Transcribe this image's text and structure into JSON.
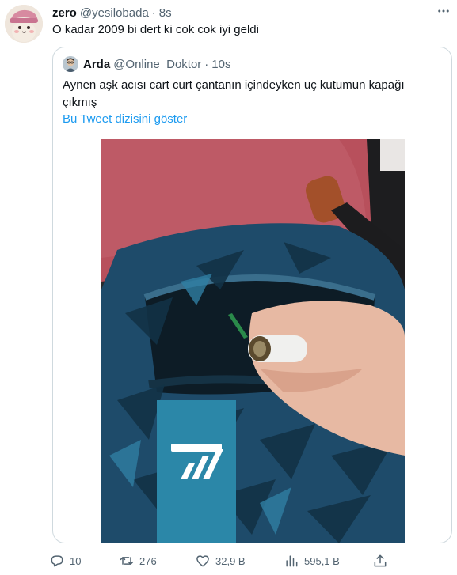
{
  "tweet": {
    "display_name": "zero",
    "handle": "@yesilobada",
    "separator": "·",
    "time": "8s",
    "text": "O kadar 2009 bi dert ki cok cok iyi geldi",
    "more_icon": "more-dots-icon"
  },
  "quote": {
    "display_name": "Arda",
    "handle": "@Online_Doktor",
    "separator": "·",
    "time": "10s",
    "text": "Aynen aşk acısı cart curt çantanın içindeyken uç kutumun kapağı çıkmış",
    "thread_link": "Bu Tweet dizisini göster",
    "media_description_icon": "photo"
  },
  "actions": {
    "reply_count": "10",
    "retweet_count": "276",
    "like_count": "32,9 B",
    "view_count": "595,1 B"
  },
  "colors": {
    "link": "#1d9bf0",
    "secondary_text": "#536471",
    "border": "#cfd9de"
  }
}
